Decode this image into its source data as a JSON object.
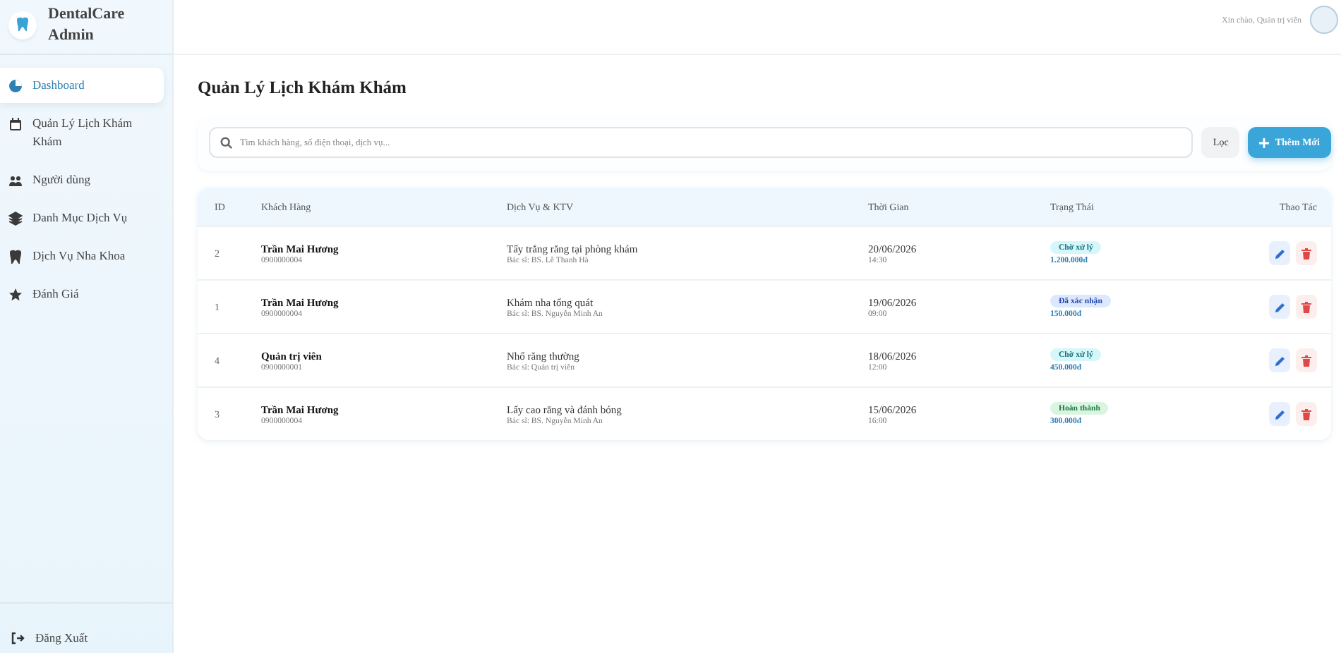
{
  "brand": {
    "title": "DentalCare Admin"
  },
  "sidebar": {
    "items": [
      {
        "label": "Dashboard",
        "kind": "chart",
        "selected": true
      },
      {
        "label": "Quản Lý Lịch Khám Khám",
        "kind": "calendar",
        "selected": false
      },
      {
        "label": "Người dùng",
        "kind": "users",
        "selected": false
      },
      {
        "label": "Danh Mục Dịch Vụ",
        "kind": "layers",
        "selected": false
      },
      {
        "label": "Dịch Vụ Nha Khoa",
        "kind": "tooth",
        "selected": false
      },
      {
        "label": "Đánh Giá",
        "kind": "star",
        "selected": false
      }
    ],
    "logout": "Đăng Xuất"
  },
  "header": {
    "greeting": "Xin chào, Quản trị viên"
  },
  "page": {
    "title": "Quản Lý Lịch Khám Khám"
  },
  "toolbar": {
    "search": {
      "placeholder": "Tìm khách hàng, số điện thoại, dịch vụ..."
    },
    "filter_button": "Lọc",
    "add_button": "Thêm Mới"
  },
  "table": {
    "columns": [
      "ID",
      "Khách Hàng",
      "Dịch Vụ & KTV",
      "Thời Gian",
      "Trạng Thái",
      "Thao Tác"
    ],
    "rows": [
      {
        "id": "2",
        "customer": "Trần Mai Hương",
        "phone": "0900000004",
        "service": "Tẩy trắng răng tại phòng khám",
        "doctor": "Bác sĩ: BS. Lê Thanh Hà",
        "date": "20/06/2026",
        "time": "14:30",
        "status": {
          "kind": "pending",
          "label": "Chờ xử lý"
        },
        "price": "1.200.000đ"
      },
      {
        "id": "1",
        "customer": "Trần Mai Hương",
        "phone": "0900000004",
        "service": "Khám nha tổng quát",
        "doctor": "Bác sĩ: BS. Nguyễn Minh An",
        "date": "19/06/2026",
        "time": "09:00",
        "status": {
          "kind": "confirmed",
          "label": "Đã xác nhận"
        },
        "price": "150.000đ"
      },
      {
        "id": "4",
        "customer": "Quản trị viên",
        "phone": "0900000001",
        "service": "Nhổ răng thường",
        "doctor": "Bác sĩ: Quản trị viên",
        "date": "18/06/2026",
        "time": "12:00",
        "status": {
          "kind": "pending",
          "label": "Chờ xử lý"
        },
        "price": "450.000đ"
      },
      {
        "id": "3",
        "customer": "Trần Mai Hương",
        "phone": "0900000004",
        "service": "Lấy cao răng và đánh bóng",
        "doctor": "Bác sĩ: BS. Nguyễn Minh An",
        "date": "15/06/2026",
        "time": "16:00",
        "status": {
          "kind": "done",
          "label": "Hoàn thành"
        },
        "price": "300.000đ"
      }
    ]
  }
}
